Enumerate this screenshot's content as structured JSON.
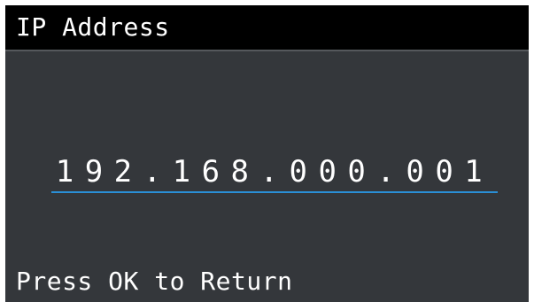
{
  "screen": {
    "title": "IP Address",
    "ip_address": "192.168.000.001",
    "footer": "Press OK to Return"
  },
  "colors": {
    "background": "#34373b",
    "title_bar": "#000000",
    "text": "#ffffff",
    "field_underline": "#2a8fd6"
  }
}
